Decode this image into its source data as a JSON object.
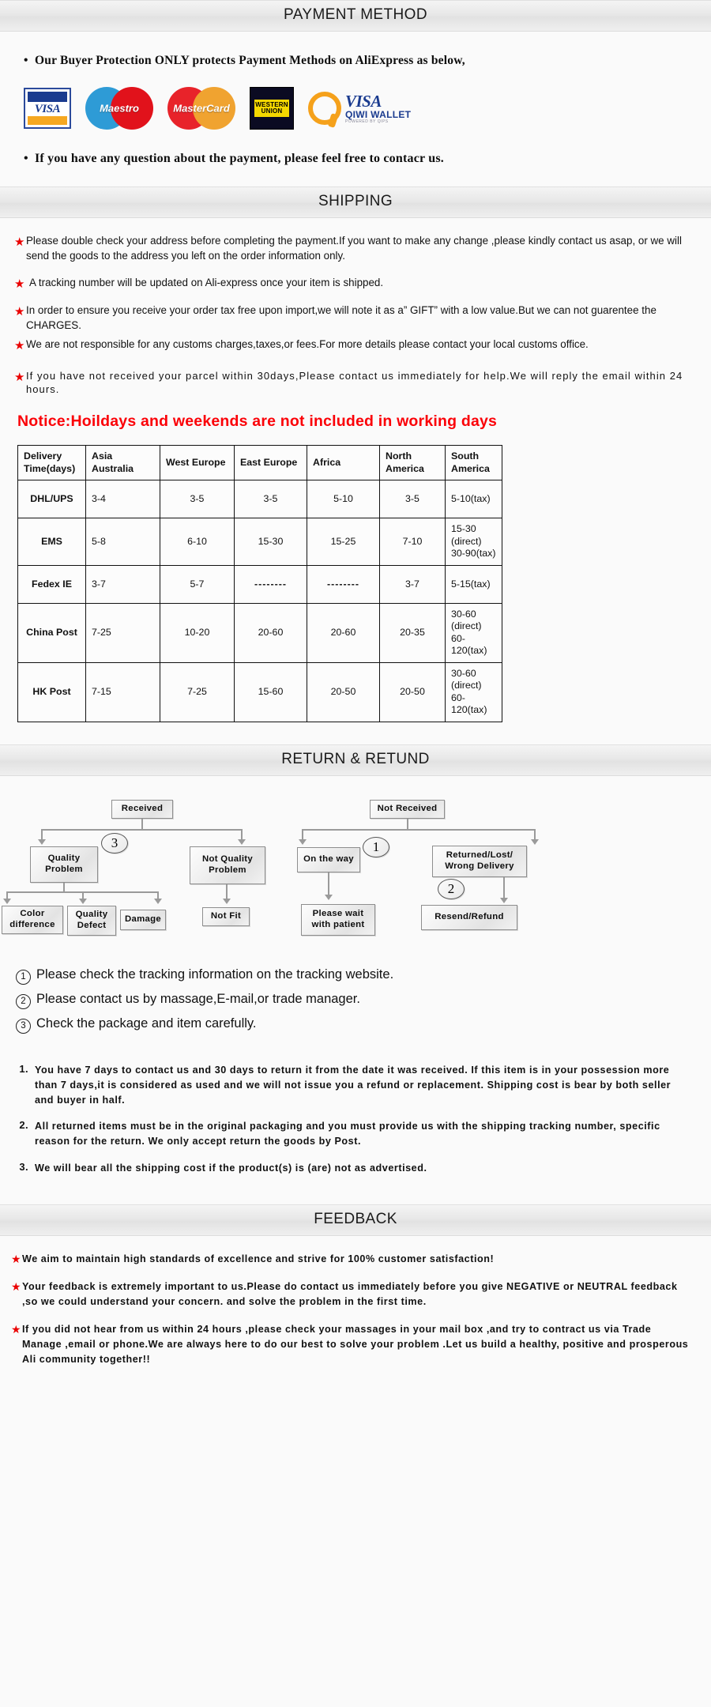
{
  "sections": {
    "payment": {
      "title": "PAYMENT METHOD"
    },
    "shipping": {
      "title": "SHIPPING"
    },
    "return": {
      "title": "RETURN & RETUND"
    },
    "feedback": {
      "title": "FEEDBACK"
    }
  },
  "payment": {
    "intro": "Our Buyer Protection ONLY protects Payment Methods on AliExpress as below,",
    "outro": "If you have any question about the payment, please feel free to contacr us.",
    "logos": [
      {
        "name": "visa-logo",
        "label": "VISA"
      },
      {
        "name": "maestro-logo",
        "label": "Maestro"
      },
      {
        "name": "mastercard-logo",
        "label": "MasterCard"
      },
      {
        "name": "western-union-logo",
        "line1": "WESTERN",
        "line2": "UNION"
      },
      {
        "name": "qiwi-wallet-logo",
        "brand": "VISA",
        "wallet": "QIWI WALLET",
        "powered": "POWERED BY QIPS"
      }
    ]
  },
  "shipping": {
    "items": [
      "Please double check your address before completing the payment.If you want to make any change ,please kindly contact us asap, or we will send the goods to the address you left on the order information only.",
      "A tracking number will be updated on Ali-express once your item is shipped.",
      "In order to ensure you receive your order tax free upon import,we will note it as a” GIFT” with a low value.But we can not guarentee the CHARGES.",
      "We are not responsible for any customs charges,taxes,or fees.For more details please contact your local customs office.",
      "If you have not received your parcel within 30days,Please contact us immediately for help.We will reply the email within 24 hours."
    ],
    "notice": "Notice:Hoildays and weekends are not included in working days",
    "table": {
      "headers": [
        "Delivery Time(days)",
        "Asia Australia",
        "West Europe",
        "East Europe",
        "Africa",
        "North America",
        "South America"
      ],
      "rows": [
        {
          "method": "DHL/UPS",
          "cells": [
            "3-4",
            "3-5",
            "3-5",
            "5-10",
            "3-5",
            "5-10(tax)"
          ]
        },
        {
          "method": "EMS",
          "cells": [
            "5-8",
            "6-10",
            "15-30",
            "15-25",
            "7-10",
            "15-30 (direct) 30-90(tax)"
          ]
        },
        {
          "method": "Fedex IE",
          "cells": [
            "3-7",
            "5-7",
            "--------",
            "--------",
            "3-7",
            "5-15(tax)"
          ]
        },
        {
          "method": "China Post",
          "cells": [
            "7-25",
            "10-20",
            "20-60",
            "20-60",
            "20-35",
            "30-60 (direct) 60-120(tax)"
          ]
        },
        {
          "method": "HK Post",
          "cells": [
            "7-15",
            "7-25",
            "15-60",
            "20-50",
            "20-50",
            "30-60 (direct) 60-120(tax)"
          ]
        }
      ]
    }
  },
  "return": {
    "flow_left": {
      "root": "Received",
      "badge": "3",
      "branch_a": "Quality Problem",
      "branch_b": "Not Quality Problem",
      "leaves_a": [
        "Color difference",
        "Quality Defect",
        "Damage"
      ],
      "leaves_b": [
        "Not Fit"
      ]
    },
    "flow_right": {
      "root": "Not  Received",
      "badge_1": "1",
      "badge_2": "2",
      "branch_a": "On the way",
      "branch_b": "Returned/Lost/ Wrong Delivery",
      "leaf_a": "Please wait with patient",
      "leaf_b": "Resend/Refund"
    },
    "numbered": [
      {
        "num": "1",
        "text": "Please check the tracking information on the tracking website."
      },
      {
        "num": "2",
        "text": "Please contact us by  massage,E-mail,or trade manager."
      },
      {
        "num": "3",
        "text": "Check the package and item carefully."
      }
    ],
    "policies": [
      {
        "num": "1.",
        "text": "You have 7 days to contact us and 30 days to return it from the date it was received. If this item is in your possession more than 7 days,it is considered as used and we will not issue you a refund or replacement. Shipping cost is bear by both seller and buyer in half."
      },
      {
        "num": "2.",
        "text": "All returned items must be in the original packaging and you must provide us with the shipping tracking number, specific reason for the return. We only accept return the goods by Post."
      },
      {
        "num": "3.",
        "text": "We will bear all the shipping cost if the product(s) is (are) not as advertised."
      }
    ]
  },
  "feedback": {
    "items": [
      "We aim to maintain high standards of excellence and strive  for 100% customer satisfaction!",
      "Your feedback is extremely important to us.Please do contact us immediately before you give NEGATIVE or NEUTRAL feedback ,so  we could understand your concern. and solve the problem in the first time.",
      "If you did not hear from us within 24 hours ,please check your massages in your mail box ,and try to contract us via Trade Manage ,email or phone.We are always here to do our best to solve your problem .Let us build a healthy, positive and prosperous Ali community together!!"
    ]
  },
  "colors": {
    "red": "#fb0007",
    "star": "#ea0000",
    "text": "#111111"
  }
}
